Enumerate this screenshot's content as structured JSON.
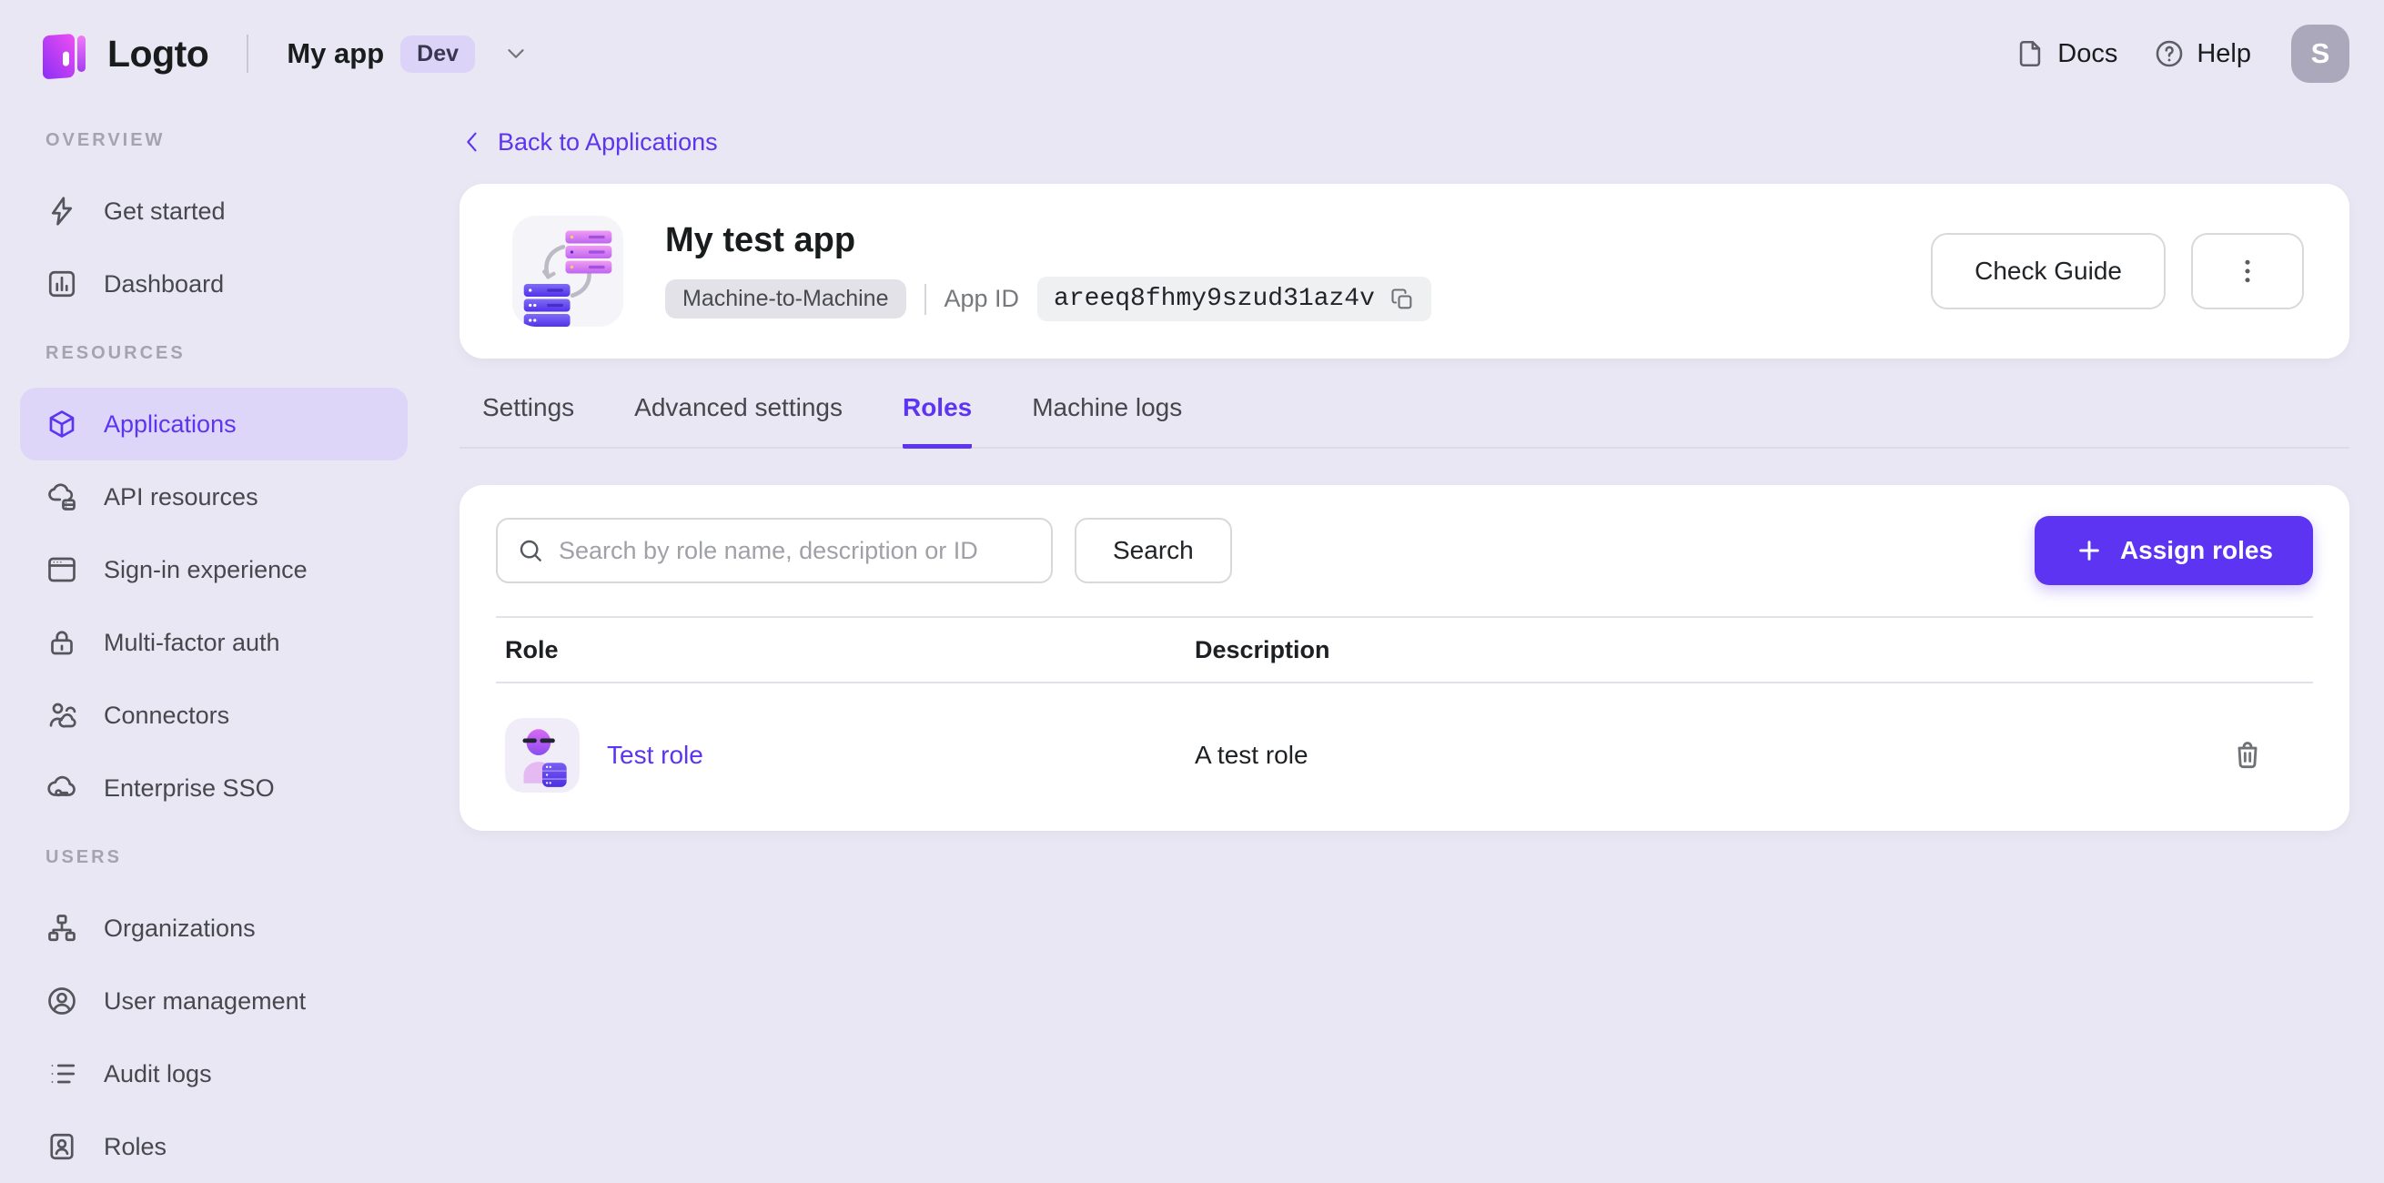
{
  "colors": {
    "accent": "#5d34f2",
    "accent_soft": "#ddd6f8",
    "page_bg": "#e9e7f3",
    "card_bg": "#ffffff",
    "dev_badge_bg": "#dcd4f8",
    "avatar_bg": "#aba8bb"
  },
  "brand": {
    "name": "Logto"
  },
  "header": {
    "app_switcher": {
      "label": "My app",
      "badge": "Dev"
    },
    "docs_label": "Docs",
    "help_label": "Help",
    "avatar_initial": "S"
  },
  "sidebar": {
    "sections": [
      {
        "label": "OVERVIEW",
        "items": [
          {
            "label": "Get started",
            "icon": "lightning-icon"
          },
          {
            "label": "Dashboard",
            "icon": "dashboard-icon"
          }
        ]
      },
      {
        "label": "RESOURCES",
        "items": [
          {
            "label": "Applications",
            "icon": "cube-icon",
            "active": true
          },
          {
            "label": "API resources",
            "icon": "cloud-server-icon"
          },
          {
            "label": "Sign-in experience",
            "icon": "browser-icon"
          },
          {
            "label": "Multi-factor auth",
            "icon": "lock-icon"
          },
          {
            "label": "Connectors",
            "icon": "person-cloud-icon"
          },
          {
            "label": "Enterprise SSO",
            "icon": "cloud-key-icon"
          }
        ]
      },
      {
        "label": "USERS",
        "items": [
          {
            "label": "Organizations",
            "icon": "org-chart-icon"
          },
          {
            "label": "User management",
            "icon": "user-circle-icon"
          },
          {
            "label": "Audit logs",
            "icon": "list-icon"
          },
          {
            "label": "Roles",
            "icon": "id-card-icon"
          }
        ]
      }
    ]
  },
  "main": {
    "back_link": "Back to Applications",
    "app_card": {
      "title": "My test app",
      "type_badge": "Machine-to-Machine",
      "app_id_label": "App ID",
      "app_id_value": "areeq8fhmy9szud31az4v",
      "check_guide_label": "Check Guide"
    },
    "tabs": [
      {
        "label": "Settings"
      },
      {
        "label": "Advanced settings"
      },
      {
        "label": "Roles",
        "active": true
      },
      {
        "label": "Machine logs"
      }
    ],
    "roles_panel": {
      "search_placeholder": "Search by role name, description or ID",
      "search_button_label": "Search",
      "assign_roles_label": "Assign roles",
      "table": {
        "columns": [
          "Role",
          "Description"
        ],
        "rows": [
          {
            "role": "Test role",
            "description": "A test role"
          }
        ]
      }
    }
  }
}
